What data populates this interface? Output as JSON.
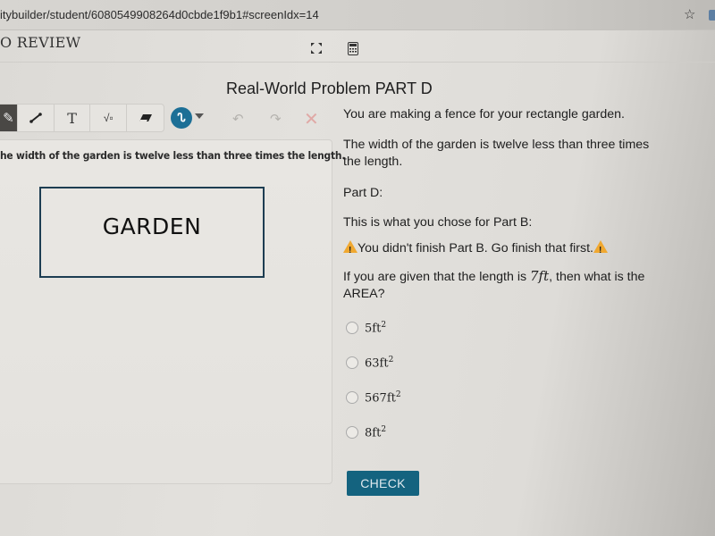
{
  "browser": {
    "url": "itybuilder/student/6080549908264d0cbde1f9b1#screenIdx=14",
    "bookmark_icon": "star-icon"
  },
  "app": {
    "title": "O REVIEW",
    "expand_icon": "expand-icon",
    "calculator_icon": "calculator-icon"
  },
  "problem": {
    "title": "Real-World Problem PART D"
  },
  "toolbar": {
    "tools": [
      {
        "name": "select",
        "glyph": "✎"
      },
      {
        "name": "line",
        "glyph": "⟋"
      },
      {
        "name": "text",
        "glyph": "T"
      },
      {
        "name": "equation",
        "glyph": "√▫"
      },
      {
        "name": "eraser",
        "glyph": "▰"
      }
    ],
    "pen_glyph": "ᔐ",
    "undo_glyph": "↶",
    "redo_glyph": "↷",
    "clear_glyph": "✕"
  },
  "canvas": {
    "statement": "he width of the garden is twelve less than three times the length.",
    "garden_label": "GARDEN"
  },
  "question": {
    "intro": "You are making a fence for your rectangle garden.",
    "width_line1": "The width of the garden is twelve less than three times",
    "width_line2": "the length.",
    "part_label": "Part D:",
    "part_b_label": "This is what you chose for Part B:",
    "warning": "You didn't finish Part B.  Go finish that first.",
    "prompt_pre": "If you are given that the length is ",
    "prompt_math": "7ft",
    "prompt_post": ", then what is the",
    "prompt_line2": "AREA?",
    "options": [
      {
        "value": "5ft",
        "exp": "2"
      },
      {
        "value": "63ft",
        "exp": "2"
      },
      {
        "value": "567ft",
        "exp": "2"
      },
      {
        "value": "8ft",
        "exp": "2"
      }
    ],
    "selected_option": null,
    "check_label": "CHECK"
  },
  "colors": {
    "accent": "#14637f",
    "pen_button": "#1c6f96",
    "warning": "#f0a830",
    "garden_border": "#1d3d52"
  }
}
